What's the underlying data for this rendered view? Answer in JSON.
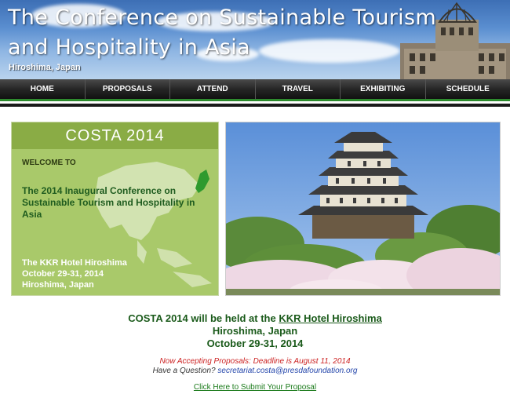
{
  "header": {
    "title_line1": "The Conference on Sustainable Tourism",
    "title_line2": "and Hospitality in Asia",
    "location": "Hiroshima, Japan"
  },
  "nav": {
    "items": [
      "HOME",
      "PROPOSALS",
      "ATTEND",
      "TRAVEL",
      "EXHIBITING",
      "SCHEDULE"
    ]
  },
  "welcome": {
    "heading": "COSTA 2014",
    "label": "WELCOME TO",
    "body": "The 2014 Inaugural Conference on Sustainable Tourism and Hospitality in Asia",
    "venue_name": "The KKR Hotel Hiroshima",
    "venue_dates": "October 29-31, 2014",
    "venue_city": "Hiroshima, Japan"
  },
  "info": {
    "line1_prefix": "COSTA 2014 will be held at the ",
    "line1_link": "KKR Hotel Hiroshima",
    "line2": "Hiroshima, Japan",
    "line3": "October 29-31, 2014",
    "deadline": "Now Accepting Proposals: Deadline is August 11, 2014",
    "question_prefix": "Have a Question? ",
    "email": "secretariat.costa@presdafoundation.org",
    "submit_link": "Click Here to Submit Your Proposal"
  },
  "colors": {
    "accent_green": "#2e8b2e",
    "panel_green": "#a9c96a",
    "nav_dark": "#262626"
  }
}
